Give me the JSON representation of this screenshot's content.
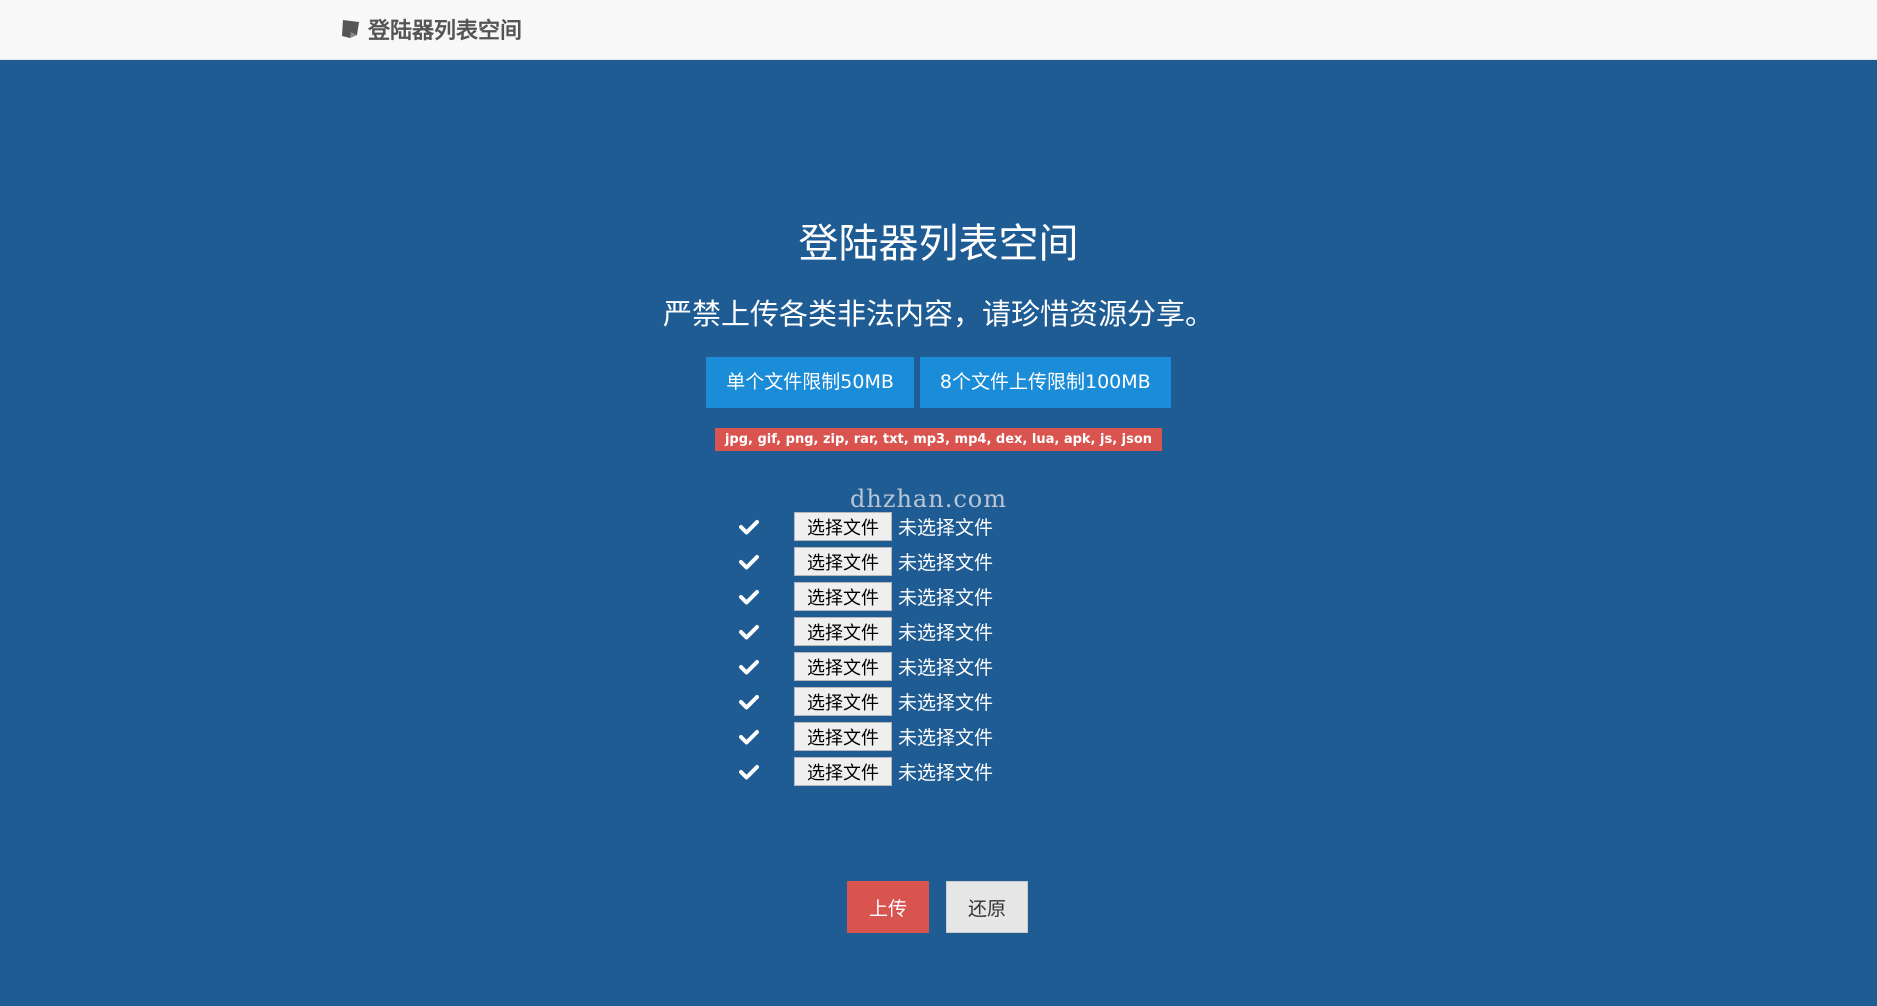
{
  "navbar": {
    "brand_icon": "note-icon",
    "brand_text": "登陆器列表空间"
  },
  "hero": {
    "title": "登陆器列表空间",
    "subtitle": "严禁上传各类非法内容，请珍惜资源分享。"
  },
  "limits": [
    {
      "label": "单个文件限制50MB"
    },
    {
      "label": "8个文件上传限制100MB"
    }
  ],
  "allowed_types": "jpg, gif, png, zip, rar, txt, mp3, mp4, dex, lua, apk, js, json",
  "watermark": "dhzhan.com",
  "files": [
    {
      "button": "选择文件",
      "status": "未选择文件",
      "icon": "check-icon"
    },
    {
      "button": "选择文件",
      "status": "未选择文件",
      "icon": "check-icon"
    },
    {
      "button": "选择文件",
      "status": "未选择文件",
      "icon": "check-icon"
    },
    {
      "button": "选择文件",
      "status": "未选择文件",
      "icon": "check-icon"
    },
    {
      "button": "选择文件",
      "status": "未选择文件",
      "icon": "check-icon"
    },
    {
      "button": "选择文件",
      "status": "未选择文件",
      "icon": "check-icon"
    },
    {
      "button": "选择文件",
      "status": "未选择文件",
      "icon": "check-icon"
    },
    {
      "button": "选择文件",
      "status": "未选择文件",
      "icon": "check-icon"
    }
  ],
  "actions": {
    "upload_label": "上传",
    "reset_label": "还原"
  },
  "colors": {
    "background": "#1f5c94",
    "navbar": "#f8f8f8",
    "limit_badge": "#1a8cd8",
    "danger": "#d9534f",
    "reset_button": "#e6e6e6"
  }
}
